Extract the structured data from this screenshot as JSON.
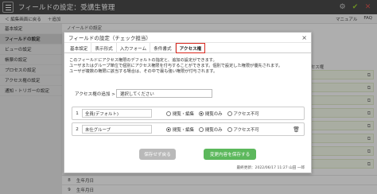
{
  "app": {
    "title": "フィールドの設定：受講生管理"
  },
  "subbar": {
    "back": "＜ 編集画面に戻る",
    "add": "＋追加",
    "manual": "マニュアル",
    "faq": "FAQ"
  },
  "sidebar": {
    "items": [
      {
        "label": "基本設定",
        "active": false
      },
      {
        "label": "フィールドの設定",
        "active": true
      },
      {
        "label": "ビューの設定",
        "active": false
      },
      {
        "label": "帳票の設定",
        "active": false
      },
      {
        "label": "プロセスの設定",
        "active": false
      },
      {
        "label": "アクセス権の設定",
        "active": false
      },
      {
        "label": "通知・トリガーの設定",
        "active": false
      }
    ]
  },
  "main": {
    "head": "ノイールドの設定",
    "col_head": "アクセス権",
    "bottom_rows": [
      {
        "num": "8",
        "name": "生年月日"
      },
      {
        "num": "9",
        "name": "生年月日"
      }
    ]
  },
  "modal": {
    "title": "フィールドの設定（チェック担当）",
    "close": "×",
    "tabs": [
      {
        "label": "基本設定",
        "active": false
      },
      {
        "label": "表示形式",
        "active": false
      },
      {
        "label": "入力フォーム",
        "active": false
      },
      {
        "label": "条件書式",
        "active": false
      },
      {
        "label": "アクセス権",
        "active": true
      }
    ],
    "description": [
      "このフィールドにアクセス権限のデフォルトの指定と、追加の設定ができます。",
      "ユーザまたはグループ単位で個別にアクセス権限を付与することができます。個別で設定した権限が優先されます。",
      "ユーザが複数の権限に該当する場合は、その中で最も強い権限が付与されます。"
    ],
    "add_label": "アクセス権の追加 >",
    "add_placeholder": "選択してください",
    "permissions": [
      {
        "num": "1",
        "name": "全員(デフォルト)",
        "options": [
          "閲覧・編集",
          "閲覧のみ",
          "アクセス不可"
        ],
        "selected": 1
      },
      {
        "num": "2",
        "name": "未仕グループ",
        "options": [
          "閲覧・編集",
          "閲覧のみ",
          "アクセス不可"
        ],
        "selected": 0
      }
    ],
    "btn_back": "保存せず戻る",
    "btn_save": "変更内容を保存する",
    "footer": "最終更新：2022/06/17 11:27 山田 一郎"
  }
}
